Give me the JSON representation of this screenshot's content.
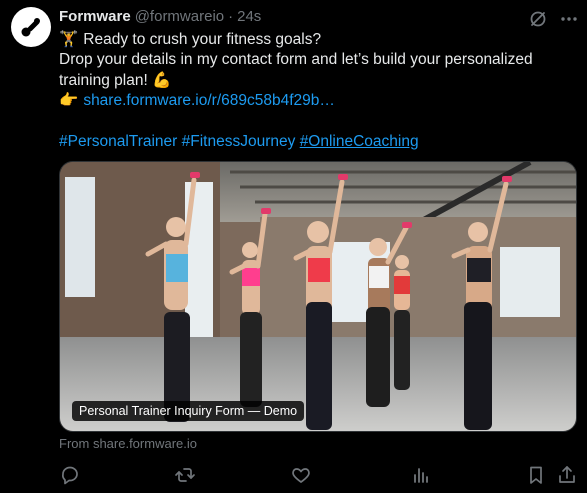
{
  "post": {
    "author_name": "Formware",
    "author_handle": "@formwareio",
    "separator": "·",
    "timestamp": "24s",
    "lines": [
      {
        "emoji": "🏋",
        "text": " Ready to crush your fitness goals?"
      },
      {
        "text": "Drop your details in my contact form and let’s build your personalized"
      },
      {
        "text": "training plan! ",
        "emoji_after": "💪"
      }
    ],
    "link_emoji": "👉",
    "link_text": "share.formware.io/r/689c58b4f29b…",
    "hashtags": [
      "#PersonalTrainer",
      "#FitnessJourney",
      "#OnlineCoaching"
    ],
    "media": {
      "caption": "Personal Trainer Inquiry Form — Demo"
    },
    "from_text": "From share.formware.io"
  },
  "icons": {
    "avatar": "formware-logo",
    "grok": "grok-icon",
    "more": "more-icon",
    "reply": "reply-icon",
    "repost": "repost-icon",
    "like": "like-icon",
    "views": "views-icon",
    "bookmark": "bookmark-icon",
    "share": "share-icon"
  },
  "colors": {
    "background": "#000000",
    "text": "#e7e9ea",
    "muted": "#71767b",
    "link": "#1d9bf0"
  }
}
